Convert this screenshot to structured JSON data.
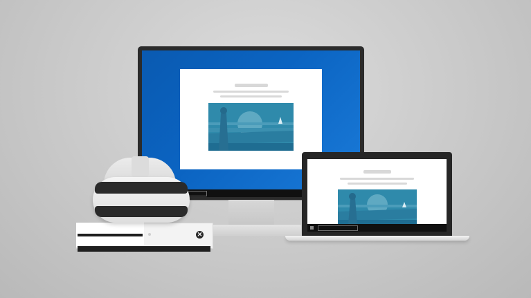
{
  "scene": {
    "description_icons": [
      "monitor-icon",
      "laptop-icon",
      "game-console-icon",
      "vr-headset-icon"
    ],
    "colors": {
      "background": "#c9c9c9",
      "desktop_blue": "#0b64c2",
      "hero_teal": "#2b88a8",
      "device_dark": "#262626",
      "device_light": "#f3f3f3"
    }
  },
  "monitor": {
    "taskbar": {
      "search_placeholder": ""
    }
  },
  "laptop": {
    "taskbar": {
      "search_placeholder": ""
    }
  },
  "console": {
    "logo_glyph": "✕"
  }
}
